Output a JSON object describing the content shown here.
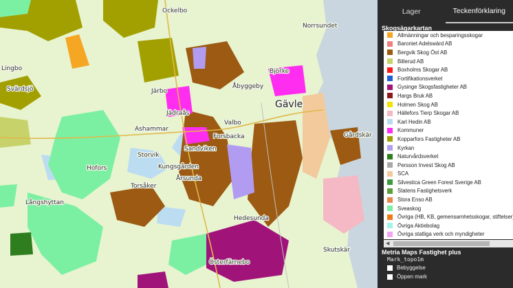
{
  "tabs": [
    {
      "label": "Lager",
      "active": false
    },
    {
      "label": "Teckenförklaring",
      "active": true
    }
  ],
  "legend_title": "Skogsägarkartan",
  "legend": [
    {
      "label": "Allmänningar och besparingsskogar",
      "color": "#f5a623"
    },
    {
      "label": "Baroniet Adelswärd AB",
      "color": "#f08080"
    },
    {
      "label": "Bergvik Skog Öst AB",
      "color": "#9c5a12"
    },
    {
      "label": "Billerud AB",
      "color": "#c8d26a"
    },
    {
      "label": "Boxholms Skogar AB",
      "color": "#ff1a1a"
    },
    {
      "label": "Fortifikationsverket",
      "color": "#1f5fd6"
    },
    {
      "label": "Gysinge Skogsfastigheter AB",
      "color": "#a0147a"
    },
    {
      "label": "Hargs Bruk AB",
      "color": "#8b1a1a"
    },
    {
      "label": "Holmen Skog AB",
      "color": "#f2e400"
    },
    {
      "label": "Hällefors Tierp Skogar AB",
      "color": "#f4b9c4"
    },
    {
      "label": "Karl Hedin AB",
      "color": "#b7dcf2"
    },
    {
      "label": "Kommuner",
      "color": "#ff2df0"
    },
    {
      "label": "Kopparfors Fastigheter AB",
      "color": "#a2a000"
    },
    {
      "label": "Kyrkan",
      "color": "#b19cf2"
    },
    {
      "label": "Naturvårdsverket",
      "color": "#2e7d1e"
    },
    {
      "label": "Persson Invest Skog AB",
      "color": "#a8a8a8"
    },
    {
      "label": "SCA",
      "color": "#f2ca9c"
    },
    {
      "label": "Silvestica Green Forest Sverige AB",
      "color": "#3d9a3d"
    },
    {
      "label": "Statens Fastighetsverk",
      "color": "#5e9e3a"
    },
    {
      "label": "Stora Enso AB",
      "color": "#e98a4c"
    },
    {
      "label": "Sveaskog",
      "color": "#7cf0a2"
    },
    {
      "label": "Övriga (HB, KB, gemensamhetsskogar, stiftelser)",
      "color": "#f07a1a"
    },
    {
      "label": "Övriga Aktiebolag",
      "color": "#a0f5e6"
    },
    {
      "label": "Övriga statliga verk och myndigheter",
      "color": "#f5a5f0"
    }
  ],
  "metria_title": "Metria Maps Fastighet plus",
  "metria_sub": "Mark_topo1m",
  "metria_items": [
    {
      "label": "Bebyggelse"
    },
    {
      "label": "Öppen mark"
    }
  ],
  "places": [
    {
      "name": "Ockelbo"
    },
    {
      "name": "Lingbo"
    },
    {
      "name": "Svärdsjö"
    },
    {
      "name": "Järbo"
    },
    {
      "name": "Åbyggeby"
    },
    {
      "name": "Björke"
    },
    {
      "name": "Gävle"
    },
    {
      "name": "Jädraås"
    },
    {
      "name": "Ashammar"
    },
    {
      "name": "Valbo"
    },
    {
      "name": "Forsbacka"
    },
    {
      "name": "Sandviken"
    },
    {
      "name": "Storvik"
    },
    {
      "name": "Kungsgården"
    },
    {
      "name": "Årsunda"
    },
    {
      "name": "Torsåker"
    },
    {
      "name": "Hofors"
    },
    {
      "name": "Långshyttan"
    },
    {
      "name": "Hedesunda"
    },
    {
      "name": "Österfärnebo"
    },
    {
      "name": "Skutskär"
    },
    {
      "name": "Gårdskär"
    },
    {
      "name": "Norrsundet"
    }
  ]
}
